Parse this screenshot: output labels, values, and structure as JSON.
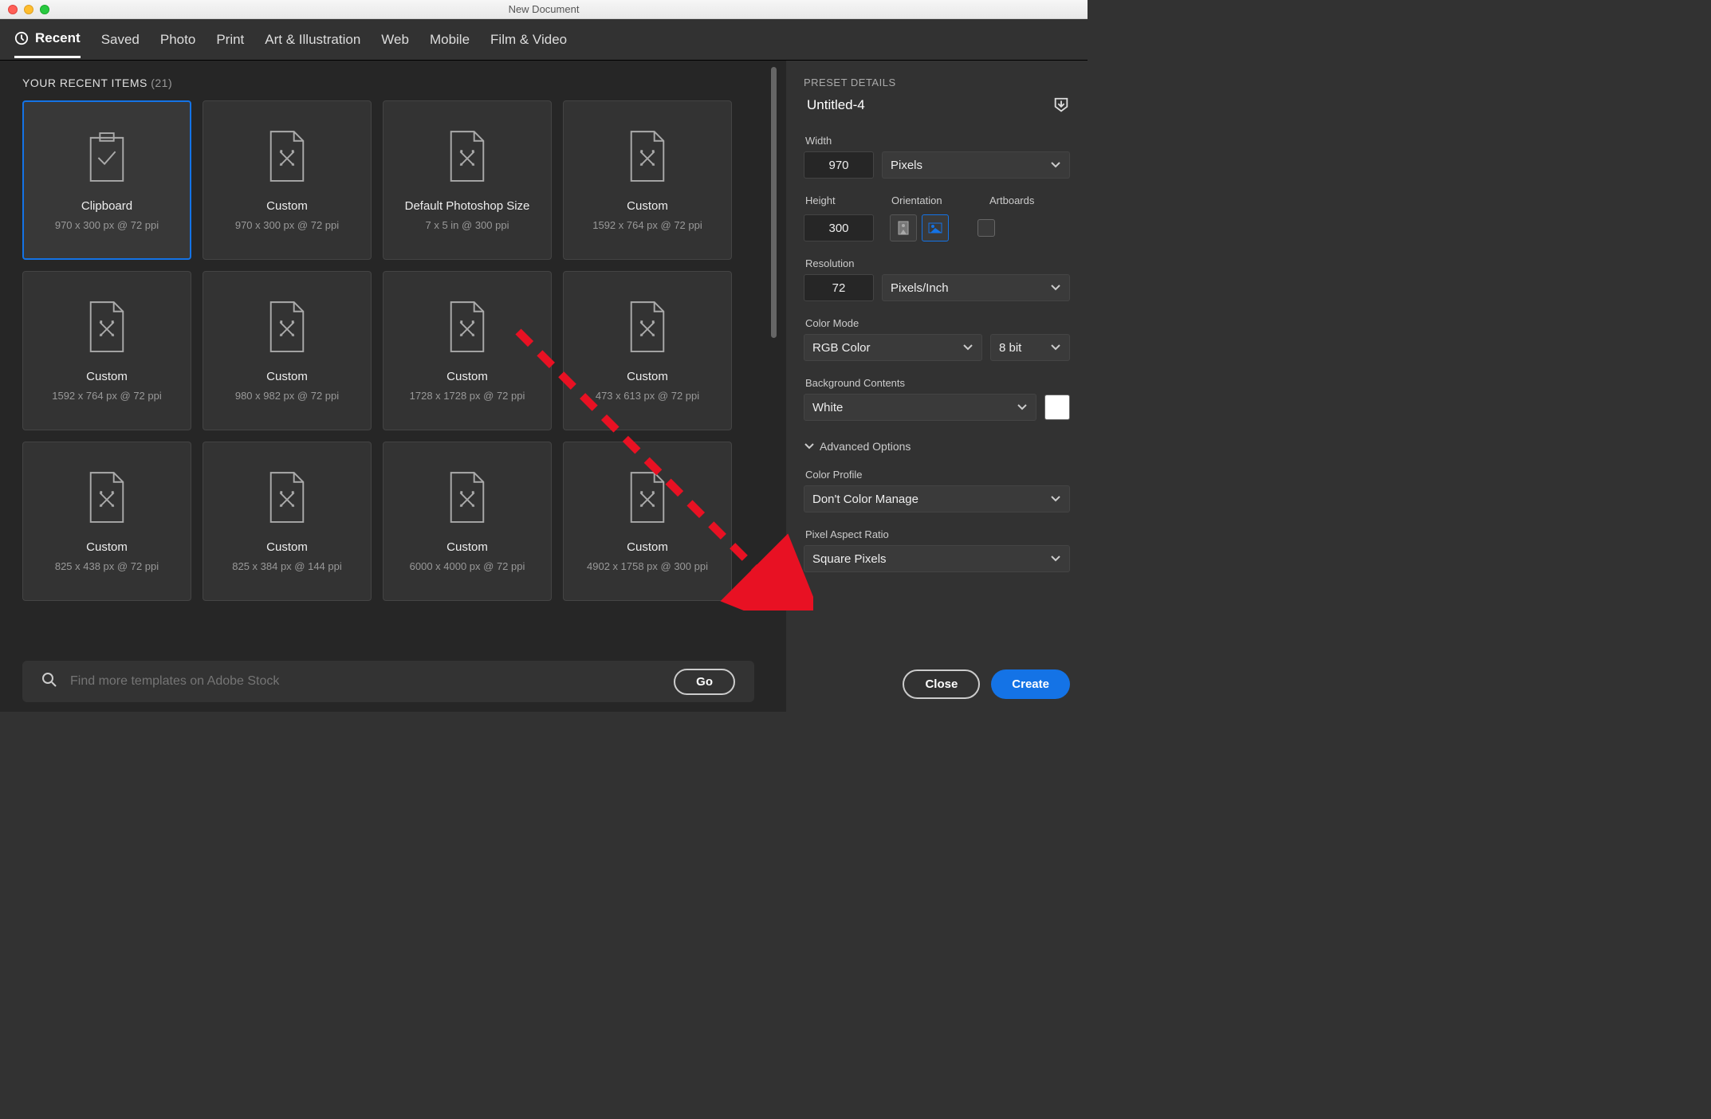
{
  "window": {
    "title": "New Document"
  },
  "tabs": [
    "Recent",
    "Saved",
    "Photo",
    "Print",
    "Art & Illustration",
    "Web",
    "Mobile",
    "Film & Video"
  ],
  "active_tab": 0,
  "recent": {
    "heading": "YOUR RECENT ITEMS",
    "count": "(21)",
    "items": [
      {
        "title": "Clipboard",
        "sub": "970 x 300 px @ 72 ppi",
        "icon": "clipboard",
        "selected": true
      },
      {
        "title": "Custom",
        "sub": "970 x 300 px @ 72 ppi",
        "icon": "doc"
      },
      {
        "title": "Default Photoshop Size",
        "sub": "7 x 5 in @ 300 ppi",
        "icon": "doc"
      },
      {
        "title": "Custom",
        "sub": "1592 x 764 px @ 72 ppi",
        "icon": "doc"
      },
      {
        "title": "Custom",
        "sub": "1592 x 764 px @ 72 ppi",
        "icon": "doc"
      },
      {
        "title": "Custom",
        "sub": "980 x 982 px @ 72 ppi",
        "icon": "doc"
      },
      {
        "title": "Custom",
        "sub": "1728 x 1728 px @ 72 ppi",
        "icon": "doc"
      },
      {
        "title": "Custom",
        "sub": "473 x 613 px @ 72 ppi",
        "icon": "doc"
      },
      {
        "title": "Custom",
        "sub": "825 x 438 px @ 72 ppi",
        "icon": "doc"
      },
      {
        "title": "Custom",
        "sub": "825 x 384 px @ 144 ppi",
        "icon": "doc"
      },
      {
        "title": "Custom",
        "sub": "6000 x 4000 px @ 72 ppi",
        "icon": "doc"
      },
      {
        "title": "Custom",
        "sub": "4902 x 1758 px @ 300 ppi",
        "icon": "doc"
      }
    ]
  },
  "search": {
    "placeholder": "Find more templates on Adobe Stock",
    "go": "Go"
  },
  "preset": {
    "header": "PRESET DETAILS",
    "name": "Untitled-4",
    "width_label": "Width",
    "width_value": "970",
    "width_unit": "Pixels",
    "height_label": "Height",
    "height_value": "300",
    "orientation_label": "Orientation",
    "orientation": "landscape",
    "artboards_label": "Artboards",
    "resolution_label": "Resolution",
    "resolution_value": "72",
    "resolution_unit": "Pixels/Inch",
    "color_mode_label": "Color Mode",
    "color_mode": "RGB Color",
    "color_depth": "8 bit",
    "bg_label": "Background Contents",
    "bg_value": "White",
    "bg_swatch": "#ffffff",
    "advanced_label": "Advanced Options",
    "color_profile_label": "Color Profile",
    "color_profile": "Don't Color Manage",
    "par_label": "Pixel Aspect Ratio",
    "par_value": "Square Pixels"
  },
  "footer": {
    "close": "Close",
    "create": "Create"
  }
}
